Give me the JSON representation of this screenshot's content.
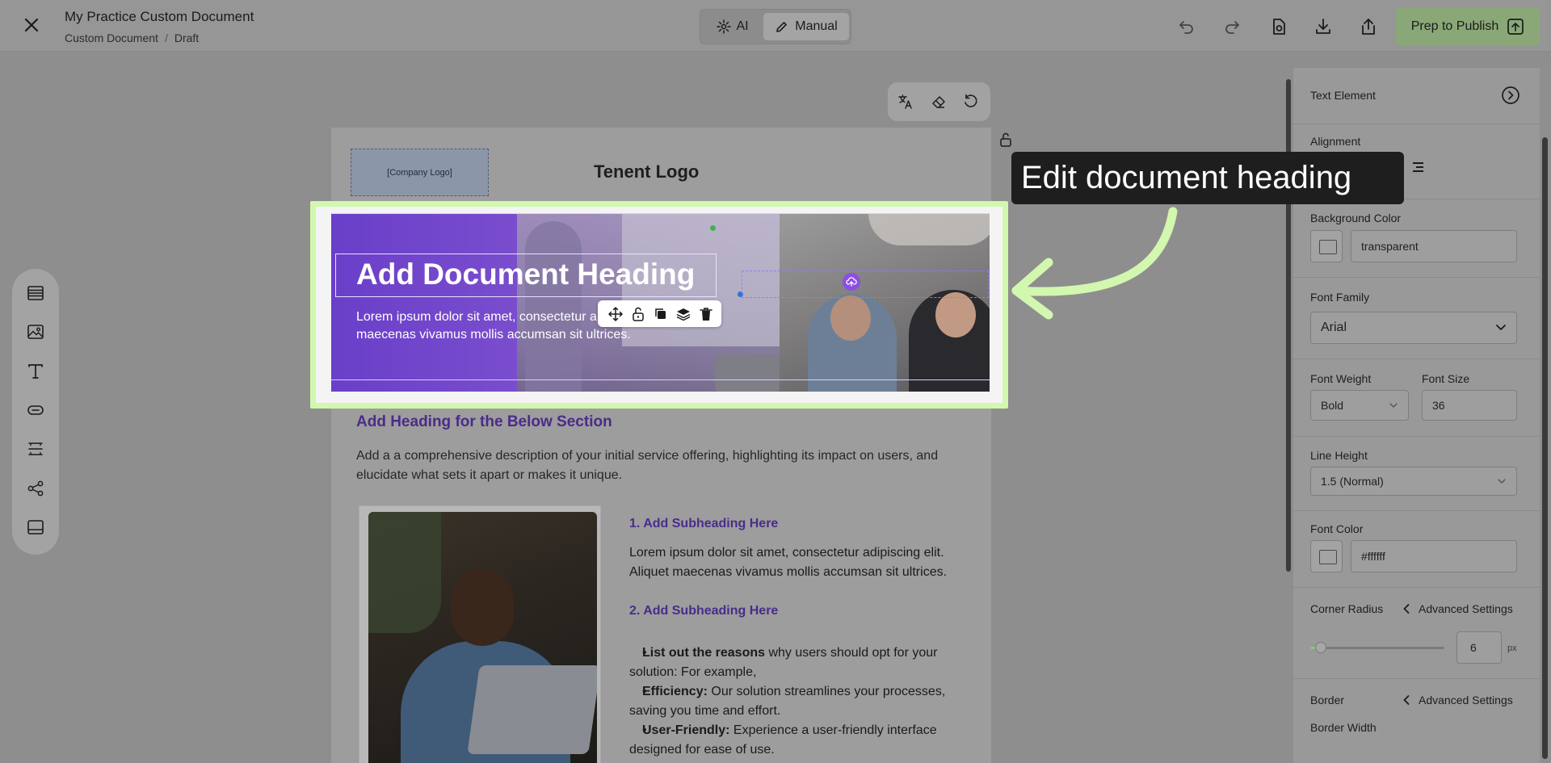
{
  "header": {
    "title": "My Practice Custom Document",
    "breadcrumb": [
      "Custom Document",
      "Draft"
    ],
    "breadcrumb_separator": "/",
    "modes": {
      "ai_label": "AI",
      "manual_label": "Manual",
      "active": "Manual"
    },
    "toolbar_icons": [
      "undo-icon",
      "redo-icon",
      "preview-icon",
      "download-icon",
      "share-icon"
    ],
    "publish_label": "Prep to Publish",
    "publish_color": "#8aa877"
  },
  "left_rail": [
    "table-icon",
    "image-icon",
    "text-icon",
    "button-icon",
    "divider-icon",
    "social-icon",
    "footer-icon"
  ],
  "document": {
    "logo_placeholder": "[Company Logo]",
    "tenant_logo": "Tenent Logo",
    "hero": {
      "heading": "Add Document Heading",
      "body": "Lorem ipsum dolor sit amet, consectetur a Aliquet maecenas vivamus mollis accumsan sit ultrices."
    },
    "section_heading": "Add Heading for the Below Section",
    "section_description": "Add a a comprehensive description of your initial service offering, highlighting its impact on users, and elucidate what sets it apart or makes it unique.",
    "subheading_1": "1. Add Subheading Here",
    "paragraph_1": "Lorem ipsum dolor sit amet, consectetur adipiscing elit. Aliquet maecenas vivamus mollis accumsan sit ultrices.",
    "subheading_2": "2. Add Subheading Here",
    "bullets": [
      {
        "bold": "List out the reasons",
        "text": " why users should opt for your solution: For example,"
      },
      {
        "bold": "Efficiency:",
        "text": " Our solution streamlines your processes, saving you time and effort."
      },
      {
        "bold": "User-Friendly:",
        "text": " Experience a user-friendly interface designed for ease of use."
      }
    ]
  },
  "panel": {
    "title": "Text Element",
    "alignment_label": "Alignment",
    "background_color_label": "Background Color",
    "background_color_value": "transparent",
    "font_family_label": "Font Family",
    "font_family_value": "Arial",
    "font_weight_label": "Font Weight",
    "font_weight_value": "Bold",
    "font_size_label": "Font Size",
    "font_size_value": "36",
    "line_height_label": "Line Height",
    "line_height_value": "1.5 (Normal)",
    "font_color_label": "Font Color",
    "font_color_value": "#ffffff",
    "corner_radius_label": "Corner Radius",
    "advanced_settings_label": "Advanced Settings",
    "corner_radius_value": "6",
    "corner_radius_unit": "px",
    "border_label": "Border",
    "border_width_label": "Border Width"
  },
  "callout": {
    "text": "Edit document heading",
    "arrow_color": "#d2f7ae"
  }
}
